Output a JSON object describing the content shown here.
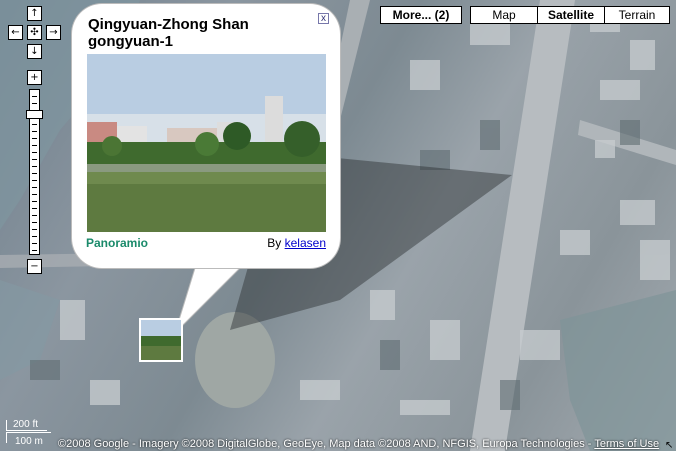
{
  "map_controls": {
    "pan_up": "↑",
    "pan_left": "←",
    "pan_center": "✣",
    "pan_right": "→",
    "pan_down": "↓",
    "zoom_in": "+",
    "zoom_out": "−"
  },
  "map_types": {
    "more_label": "More... (2)",
    "map_label": "Map",
    "satellite_label": "Satellite",
    "terrain_label": "Terrain",
    "selected": "Satellite"
  },
  "info_window": {
    "title": "Qingyuan-Zhong Shan gongyuan-1",
    "close": "x",
    "brand": "Panoramio",
    "by_text": "By",
    "author": "kelasen"
  },
  "scale": {
    "imperial": "200 ft",
    "metric": "100 m"
  },
  "attribution": {
    "text": "©2008 Google - Imagery ©2008 DigitalGlobe, GeoEye, Map data ©2008 AND, NFGIS, Europa Technologies -",
    "terms_link": "Terms of Use"
  },
  "colors": {
    "brand": "#1a8a6a",
    "link": "#0000cc"
  }
}
